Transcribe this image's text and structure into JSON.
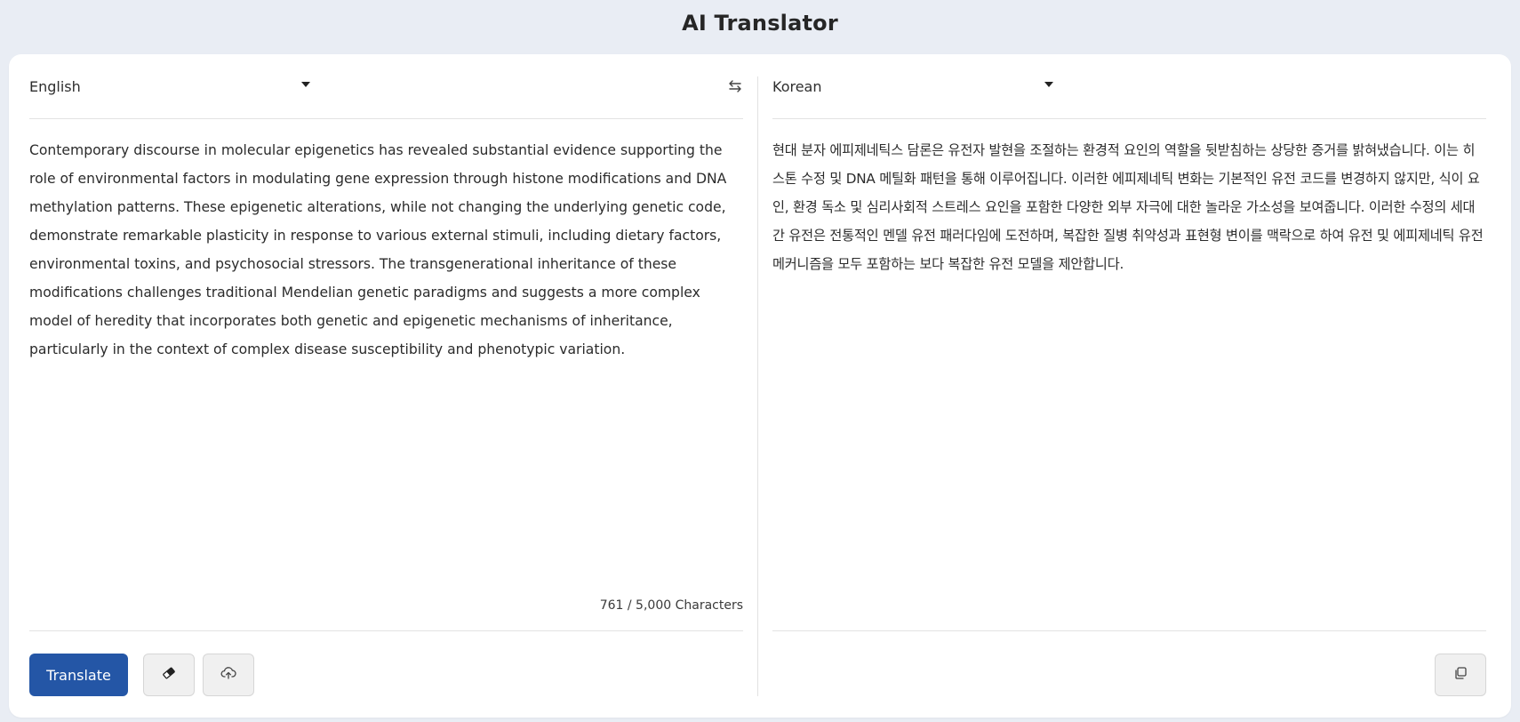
{
  "header": {
    "title": "AI Translator"
  },
  "source": {
    "language": "English",
    "text": "Contemporary discourse in molecular epigenetics has revealed substantial evidence supporting the role of environmental factors in modulating gene expression through histone modifications and DNA methylation patterns. These epigenetic alterations, while not changing the underlying genetic code, demonstrate remarkable plasticity in response to various external stimuli, including dietary factors, environmental toxins, and psychosocial stressors. The transgenerational inheritance of these modifications challenges traditional Mendelian genetic paradigms and suggests a more complex model of heredity that incorporates both genetic and epigenetic mechanisms of inheritance, particularly in the context of complex disease susceptibility and phenotypic variation.",
    "char_count": "761 / 5,000 Characters"
  },
  "target": {
    "language": "Korean",
    "text": "현대 분자 에피제네틱스 담론은 유전자 발현을 조절하는 환경적 요인의 역할을 뒷받침하는 상당한 증거를 밝혀냈습니다. 이는 히스톤 수정 및 DNA 메틸화 패턴을 통해 이루어집니다. 이러한 에피제네틱 변화는 기본적인 유전 코드를 변경하지 않지만, 식이 요인, 환경 독소 및 심리사회적 스트레스 요인을 포함한 다양한 외부 자극에 대한 놀라운 가소성을 보여줍니다. 이러한 수정의 세대 간 유전은 전통적인 멘델 유전 패러다임에 도전하며, 복잡한 질병 취약성과 표현형 변이를 맥락으로 하여 유전 및 에피제네틱 유전 메커니즘을 모두 포함하는 보다 복잡한 유전 모델을 제안합니다."
  },
  "actions": {
    "translate_label": "Translate"
  },
  "icons": {
    "swap": "swap-arrows-icon",
    "clear": "eraser-icon",
    "upload": "cloud-upload-icon",
    "copy": "copy-icon"
  },
  "colors": {
    "accent": "#2456a6",
    "background": "#e9edf4"
  }
}
